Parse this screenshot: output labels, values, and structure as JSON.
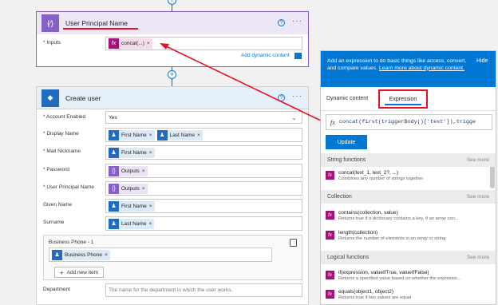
{
  "upn_card": {
    "title": "User Principal Name",
    "inputs_label": "Inputs",
    "token_label": "concat(...)",
    "add_dynamic": "Add dynamic content",
    "help": "?",
    "more": "···"
  },
  "create_card": {
    "title": "Create user",
    "help": "?",
    "more": "···",
    "fields": {
      "account_enabled": {
        "label": "Account Enabled",
        "value": "Yes"
      },
      "display_name": {
        "label": "Display Name",
        "tokens": [
          "First Name",
          "Last Name"
        ]
      },
      "mail_nickname": {
        "label": "Mail Nickname",
        "tokens": [
          "First Name"
        ]
      },
      "password": {
        "label": "Password",
        "tokens": [
          "Outputs"
        ]
      },
      "upn": {
        "label": "User Principal Name",
        "tokens": [
          "Outputs"
        ]
      },
      "given_name": {
        "label": "Given Name",
        "tokens": [
          "First Name"
        ]
      },
      "surname": {
        "label": "Surname",
        "tokens": [
          "Last Name"
        ]
      }
    },
    "business_phone": {
      "label": "Business Phone - 1",
      "token": "Business Phone",
      "add_item": "Add new item"
    },
    "department": {
      "label": "Department",
      "placeholder": "The name for the department in which the user works."
    }
  },
  "panel": {
    "info": "Add an expression to do basic things like access, convert, and compare values.",
    "learn_more": "Learn more about dynamic content.",
    "hide": "Hide",
    "tabs": [
      "Dynamic content",
      "Expression"
    ],
    "expression": "concat(first(triggerBody()['text']),trigge",
    "fx": "fx",
    "update": "Update",
    "sections": [
      {
        "title": "String functions",
        "more": "See more",
        "items": [
          {
            "name": "concat(text_1, text_2?, ...)",
            "desc": "Combines any number of strings together"
          }
        ]
      },
      {
        "title": "Collection",
        "more": "See more",
        "items": [
          {
            "name": "contains(collection, value)",
            "desc": "Returns true if a dictionary contains a key, if an array con..."
          },
          {
            "name": "length(collection)",
            "desc": "Returns the number of elements in an array or string"
          }
        ]
      },
      {
        "title": "Logical functions",
        "more": "See more",
        "items": [
          {
            "name": "if(expression, valueIfTrue, valueIfFalse)",
            "desc": "Returns a specified value based on whether the expressio..."
          },
          {
            "name": "equals(object1, object2)",
            "desc": "Returns true if two values are equal"
          }
        ]
      }
    ]
  },
  "colors": {
    "accent": "#0078d4",
    "annotation": "#e81123",
    "compose_icon": "#8661c5",
    "azure_ad": "#1f6cc1",
    "expression": "#a4127a"
  }
}
